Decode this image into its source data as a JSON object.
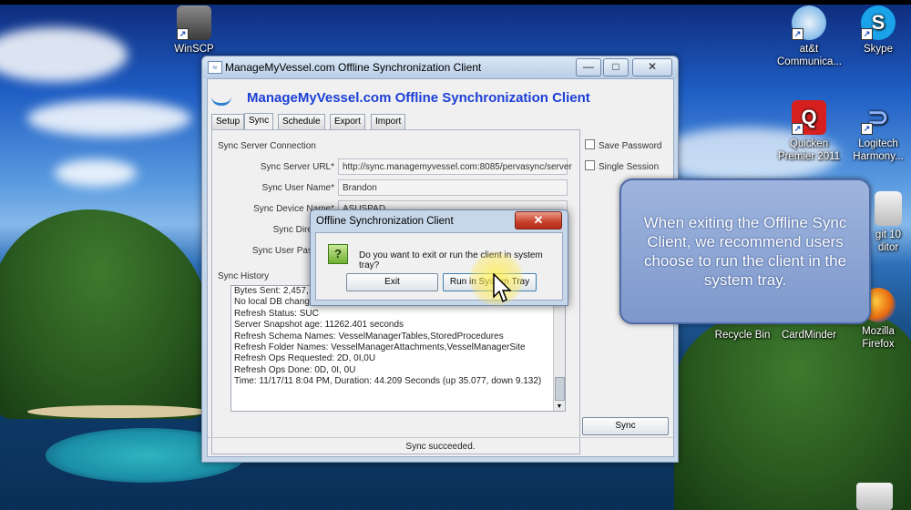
{
  "desktop": {
    "icons": [
      {
        "label": "WinSCP",
        "icon": "winscp-icon"
      },
      {
        "label": "at&t Communica...",
        "icon": "att-icon"
      },
      {
        "label": "Skype",
        "icon": "skype-icon"
      },
      {
        "label": "Quicken Premier 2011",
        "icon": "quicken-icon"
      },
      {
        "label": "Logitech Harmony...",
        "icon": "logitech-icon"
      },
      {
        "label": "Recycle Bin",
        "icon": "recycle-bin-icon"
      },
      {
        "label": "CardMinder",
        "icon": "cardminder-icon"
      },
      {
        "label": "Mozilla Firefox",
        "icon": "firefox-icon"
      },
      {
        "label": "git 10 ditor",
        "icon": "editor-icon"
      }
    ]
  },
  "window": {
    "title": "ManageMyVessel.com Offline Synchronization Client",
    "heading": "ManageMyVessel.com Offline Synchronization Client",
    "minimize": "—",
    "maximize": "□",
    "close": "✕",
    "tabs": [
      "Setup",
      "Sync",
      "Schedule",
      "Export",
      "Import"
    ],
    "active_tab": "Sync",
    "group_connection": "Sync Server Connection",
    "fields": [
      {
        "label": "Sync Server URL*",
        "value": "http://sync.managemyvessel.com:8085/pervasync/server"
      },
      {
        "label": "Sync User Name*",
        "value": "Brandon"
      },
      {
        "label": "Sync Device Name*",
        "value": "ASUSPAD"
      },
      {
        "label": "Sync Dire",
        "value": ""
      },
      {
        "label": "Sync User Pass",
        "value": ""
      }
    ],
    "save_password": "Save Password",
    "single_session": "Single Session",
    "group_history": "Sync History",
    "history": [
      "Bytes Sent: 2,457, Rec...",
      "No local DB changes",
      "Refresh Status: SUC",
      "Server Snapshot age: 11262.401 seconds",
      "Refresh Schema Names: VesselManagerTables,StoredProcedures",
      "Refresh Folder Names: VesselManagerAttachments,VesselManagerSite",
      "Refresh Ops Requested: 2D, 0I,0U",
      "Refresh Ops Done:     0D, 0I, 0U",
      "Time: 11/17/11 8:04 PM, Duration: 44.209 Seconds (up 35.077, down 9.132)"
    ],
    "sync_button": "Sync",
    "status": "Sync succeeded."
  },
  "dialog": {
    "title": "Offline Synchronization Client",
    "close": "✕",
    "question_icon": "?",
    "message": "Do you want to exit or run the client in system tray?",
    "exit_button": "Exit",
    "tray_button": "Run in System Tray"
  },
  "callout": {
    "text": "When exiting the Offline Sync Client, we recommend users choose to run the client in the system tray."
  }
}
